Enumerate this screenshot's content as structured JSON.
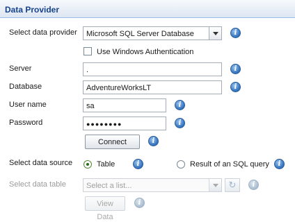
{
  "header": {
    "title": "Data Provider"
  },
  "provider": {
    "label": "Select data provider",
    "value": "Microsoft SQL Server Database",
    "windows_auth_label": "Use Windows Authentication"
  },
  "server": {
    "label": "Server",
    "value": "."
  },
  "database": {
    "label": "Database",
    "value": "AdventureWorksLT"
  },
  "username": {
    "label": "User name",
    "value": "sa"
  },
  "password": {
    "label": "Password",
    "value": "●●●●●●●●"
  },
  "connect": {
    "label": "Connect"
  },
  "source": {
    "label": "Select data source",
    "option_table": "Table",
    "option_query": "Result of an SQL query"
  },
  "table": {
    "label": "Select data table",
    "placeholder": "Select a list...",
    "view_label": "View Data"
  },
  "info_glyph": "i"
}
